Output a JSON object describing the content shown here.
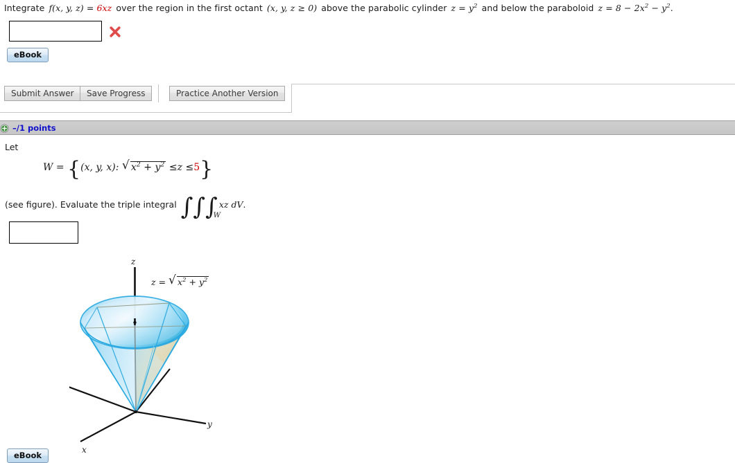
{
  "question1": {
    "statement": {
      "lead": "Integrate",
      "function_name": "f(x, y, z)",
      "equals": "=",
      "function_value": "6xz",
      "mid1": "over the region in the first octant",
      "octant_condition": "(x, y, z ≥ 0)",
      "mid2": "above the parabolic cylinder",
      "cylinder_lhs": "z",
      "cylinder_eq": "=",
      "cylinder_base": "y",
      "cylinder_exp": "2",
      "mid3": "and below the paraboloid",
      "paraboloid_lhs": "z",
      "paraboloid_eq": "=",
      "paraboloid_rhs": "8 − 2x",
      "paraboloid_exp1": "2",
      "paraboloid_rhs2": "− y",
      "paraboloid_exp2": "2",
      "period": "."
    },
    "answer_value": "",
    "answer_placeholder": "",
    "mark": "incorrect",
    "ebook_label": "eBook"
  },
  "action_bar": {
    "submit_label": "Submit Answer",
    "save_label": "Save Progress",
    "practice_label": "Practice Another Version"
  },
  "points_bar": {
    "expand_icon": "plus-circle-icon",
    "points_text": "–/1 points"
  },
  "question2": {
    "let_text": "Let",
    "set": {
      "name": "W",
      "equals": "=",
      "open_brace": "{",
      "tuple": "(x, y, x):",
      "radical_symbol": "√",
      "radicand_x": "x",
      "radicand_x_exp": "2",
      "radicand_plus": "+",
      "radicand_y": "y",
      "radicand_y_exp": "2",
      "le1": "≤",
      "variable_z": "z",
      "le2": "≤",
      "upper_bound": "5",
      "close_brace": "}"
    },
    "evaluate": {
      "see_figure": "(see figure). Evaluate the triple integral",
      "integral_symbol": "∫",
      "integral_count": 3,
      "domain_subscript": "W",
      "integrand": "xz dV",
      "period": "."
    },
    "answer_value": "",
    "answer_placeholder": "",
    "ebook_label": "eBook"
  },
  "figure": {
    "name": "cone-figure",
    "equation": {
      "lhs": "z",
      "equals": "=",
      "radical_symbol": "√",
      "radicand_x": "x",
      "radicand_x_exp": "2",
      "radicand_plus": "+",
      "radicand_y": "y",
      "radicand_y_exp": "2"
    },
    "axis_labels": {
      "x": "x",
      "y": "y",
      "z": "z"
    },
    "colors": {
      "cone_surface_light": "#cfeafa",
      "cone_surface_mid": "#6dc8ee",
      "cone_edge": "#29a9e1",
      "interior_wedge": "#ded9b8",
      "axis": "#111111"
    }
  },
  "colors": {
    "accent_red": "#cc0000",
    "points_text": "#1111cc",
    "points_bar_bg": "#c9c9c9",
    "ebook_border": "#7f9db9"
  }
}
